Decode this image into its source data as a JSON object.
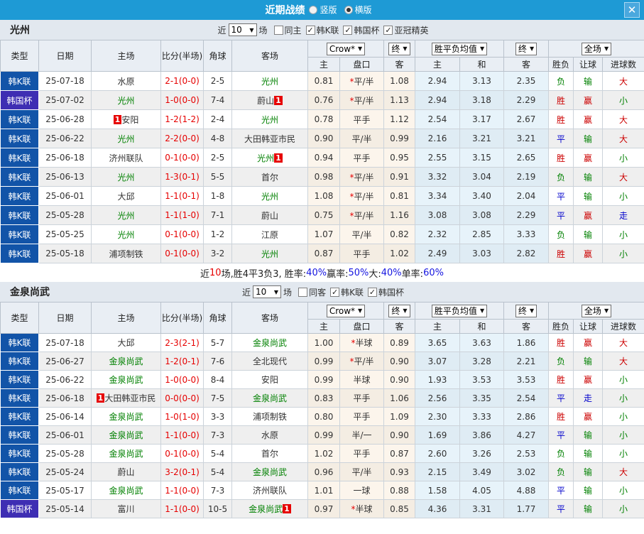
{
  "titlebar": {
    "title": "近期战绩",
    "radios": [
      {
        "label": "竖版",
        "checked": false
      },
      {
        "label": "横版",
        "checked": true
      }
    ],
    "close": "✕"
  },
  "colors": {
    "titlebar_blue": "#1e9ad5",
    "league_badge_blue": "#1254a8",
    "cup_badge_purple": "#3e2eb3",
    "focus_team_green": "#008000",
    "score_red": "#e60000",
    "win_red": "#cc0000",
    "draw_blue": "#0000cc",
    "lose_green": "#008000",
    "odds_col_cream": "#fcf5ec",
    "avg_col_blue": "#e7f3fa"
  },
  "sections": [
    {
      "team": "光州",
      "filter": {
        "near_label": "近",
        "count": "10",
        "matches_label": "场",
        "checkboxes": [
          {
            "label": "同主",
            "checked": false
          },
          {
            "label": "韩K联",
            "checked": true
          },
          {
            "label": "韩国杯",
            "checked": true
          },
          {
            "label": "亚冠精英",
            "checked": true
          }
        ]
      },
      "header": {
        "cols": [
          "类型",
          "日期",
          "主场",
          "比分(半场)",
          "角球",
          "客场"
        ],
        "book_select": "Crow*",
        "final_select1": "终",
        "avg_select": "胜平负均值",
        "final_select2": "终",
        "scope_select": "全场",
        "sub_cols": [
          "主",
          "盘口",
          "客",
          "主",
          "和",
          "客",
          "胜负",
          "让球",
          "进球数"
        ]
      },
      "rows": [
        {
          "league": "韩K联",
          "date": "25-07-18",
          "home": {
            "name": "水原"
          },
          "score": "2-1(0-0)",
          "corner": "2-5",
          "away": {
            "name": "光州",
            "focus": true
          },
          "crow": [
            "0.81",
            "*平/半",
            "1.08"
          ],
          "avg": [
            "2.94",
            "3.13",
            "2.35"
          ],
          "res": [
            "负",
            "输",
            "大"
          ]
        },
        {
          "league": "韩国杯",
          "date": "25-07-02",
          "home": {
            "name": "光州",
            "focus": true
          },
          "score": "1-0(0-0)",
          "corner": "7-4",
          "away": {
            "name": "蔚山",
            "badge_post": "1"
          },
          "crow": [
            "0.76",
            "*平/半",
            "1.13"
          ],
          "avg": [
            "2.94",
            "3.18",
            "2.29"
          ],
          "res": [
            "胜",
            "赢",
            "小"
          ]
        },
        {
          "league": "韩K联",
          "date": "25-06-28",
          "home": {
            "name": "安阳",
            "badge_pre": "1"
          },
          "score": "1-2(1-2)",
          "corner": "2-4",
          "away": {
            "name": "光州",
            "focus": true
          },
          "crow": [
            "0.78",
            "平手",
            "1.12"
          ],
          "avg": [
            "2.54",
            "3.17",
            "2.67"
          ],
          "res": [
            "胜",
            "赢",
            "大"
          ]
        },
        {
          "league": "韩K联",
          "date": "25-06-22",
          "home": {
            "name": "光州",
            "focus": true
          },
          "score": "2-2(0-0)",
          "corner": "4-8",
          "away": {
            "name": "大田韩亚市民"
          },
          "crow": [
            "0.90",
            "平/半",
            "0.99"
          ],
          "avg": [
            "2.16",
            "3.21",
            "3.21"
          ],
          "res": [
            "平",
            "输",
            "大"
          ]
        },
        {
          "league": "韩K联",
          "date": "25-06-18",
          "home": {
            "name": "济州联队"
          },
          "score": "0-1(0-0)",
          "corner": "2-5",
          "away": {
            "name": "光州",
            "focus": true,
            "badge_post": "1"
          },
          "crow": [
            "0.94",
            "平手",
            "0.95"
          ],
          "avg": [
            "2.55",
            "3.15",
            "2.65"
          ],
          "res": [
            "胜",
            "赢",
            "小"
          ]
        },
        {
          "league": "韩K联",
          "date": "25-06-13",
          "home": {
            "name": "光州",
            "focus": true
          },
          "score": "1-3(0-1)",
          "corner": "5-5",
          "away": {
            "name": "首尔"
          },
          "crow": [
            "0.98",
            "*平/半",
            "0.91"
          ],
          "avg": [
            "3.32",
            "3.04",
            "2.19"
          ],
          "res": [
            "负",
            "输",
            "大"
          ]
        },
        {
          "league": "韩K联",
          "date": "25-06-01",
          "home": {
            "name": "大邱"
          },
          "score": "1-1(0-1)",
          "corner": "1-8",
          "away": {
            "name": "光州",
            "focus": true
          },
          "crow": [
            "1.08",
            "*平/半",
            "0.81"
          ],
          "avg": [
            "3.34",
            "3.40",
            "2.04"
          ],
          "res": [
            "平",
            "输",
            "小"
          ]
        },
        {
          "league": "韩K联",
          "date": "25-05-28",
          "home": {
            "name": "光州",
            "focus": true
          },
          "score": "1-1(1-0)",
          "corner": "7-1",
          "away": {
            "name": "蔚山"
          },
          "crow": [
            "0.75",
            "*平/半",
            "1.16"
          ],
          "avg": [
            "3.08",
            "3.08",
            "2.29"
          ],
          "res": [
            "平",
            "赢",
            "走"
          ]
        },
        {
          "league": "韩K联",
          "date": "25-05-25",
          "home": {
            "name": "光州",
            "focus": true
          },
          "score": "0-1(0-0)",
          "corner": "1-2",
          "away": {
            "name": "江原"
          },
          "crow": [
            "1.07",
            "平/半",
            "0.82"
          ],
          "avg": [
            "2.32",
            "2.85",
            "3.33"
          ],
          "res": [
            "负",
            "输",
            "小"
          ]
        },
        {
          "league": "韩K联",
          "date": "25-05-18",
          "home": {
            "name": "浦项制铁"
          },
          "score": "0-1(0-0)",
          "corner": "3-2",
          "away": {
            "name": "光州",
            "focus": true
          },
          "crow": [
            "0.87",
            "平手",
            "1.02"
          ],
          "avg": [
            "2.49",
            "3.03",
            "2.82"
          ],
          "res": [
            "胜",
            "赢",
            "小"
          ]
        }
      ],
      "summary": {
        "parts": [
          {
            "text": "近",
            "color": "black"
          },
          {
            "text": "10",
            "color": "red"
          },
          {
            "text": "场,胜4平3负3, 胜率:",
            "color": "black"
          },
          {
            "text": "40%",
            "color": "blue"
          },
          {
            "text": " 赢率:",
            "color": "black"
          },
          {
            "text": "50%",
            "color": "blue"
          },
          {
            "text": " 大:",
            "color": "black"
          },
          {
            "text": "40%",
            "color": "blue"
          },
          {
            "text": " 单率:",
            "color": "black"
          },
          {
            "text": "60%",
            "color": "blue"
          }
        ]
      }
    },
    {
      "team": "金泉尚武",
      "filter": {
        "near_label": "近",
        "count": "10",
        "matches_label": "场",
        "checkboxes": [
          {
            "label": "同客",
            "checked": false
          },
          {
            "label": "韩K联",
            "checked": true
          },
          {
            "label": "韩国杯",
            "checked": true
          }
        ]
      },
      "header": {
        "cols": [
          "类型",
          "日期",
          "主场",
          "比分(半场)",
          "角球",
          "客场"
        ],
        "book_select": "Crow*",
        "final_select1": "终",
        "avg_select": "胜平负均值",
        "final_select2": "终",
        "scope_select": "全场",
        "sub_cols": [
          "主",
          "盘口",
          "客",
          "主",
          "和",
          "客",
          "胜负",
          "让球",
          "进球数"
        ]
      },
      "rows": [
        {
          "league": "韩K联",
          "date": "25-07-18",
          "home": {
            "name": "大邱"
          },
          "score": "2-3(2-1)",
          "corner": "5-7",
          "away": {
            "name": "金泉尚武",
            "focus": true
          },
          "crow": [
            "1.00",
            "*半球",
            "0.89"
          ],
          "avg": [
            "3.65",
            "3.63",
            "1.86"
          ],
          "res": [
            "胜",
            "赢",
            "大"
          ]
        },
        {
          "league": "韩K联",
          "date": "25-06-27",
          "home": {
            "name": "金泉尚武",
            "focus": true
          },
          "score": "1-2(0-1)",
          "corner": "7-6",
          "away": {
            "name": "全北现代"
          },
          "crow": [
            "0.99",
            "*平/半",
            "0.90"
          ],
          "avg": [
            "3.07",
            "3.28",
            "2.21"
          ],
          "res": [
            "负",
            "输",
            "大"
          ]
        },
        {
          "league": "韩K联",
          "date": "25-06-22",
          "home": {
            "name": "金泉尚武",
            "focus": true
          },
          "score": "1-0(0-0)",
          "corner": "8-4",
          "away": {
            "name": "安阳"
          },
          "crow": [
            "0.99",
            "半球",
            "0.90"
          ],
          "avg": [
            "1.93",
            "3.53",
            "3.53"
          ],
          "res": [
            "胜",
            "赢",
            "小"
          ]
        },
        {
          "league": "韩K联",
          "date": "25-06-18",
          "home": {
            "name": "大田韩亚市民",
            "badge_pre": "1"
          },
          "score": "0-0(0-0)",
          "corner": "7-5",
          "away": {
            "name": "金泉尚武",
            "focus": true
          },
          "crow": [
            "0.83",
            "平手",
            "1.06"
          ],
          "avg": [
            "2.56",
            "3.35",
            "2.54"
          ],
          "res": [
            "平",
            "走",
            "小"
          ]
        },
        {
          "league": "韩K联",
          "date": "25-06-14",
          "home": {
            "name": "金泉尚武",
            "focus": true
          },
          "score": "1-0(1-0)",
          "corner": "3-3",
          "away": {
            "name": "浦项制铁"
          },
          "crow": [
            "0.80",
            "平手",
            "1.09"
          ],
          "avg": [
            "2.30",
            "3.33",
            "2.86"
          ],
          "res": [
            "胜",
            "赢",
            "小"
          ]
        },
        {
          "league": "韩K联",
          "date": "25-06-01",
          "home": {
            "name": "金泉尚武",
            "focus": true
          },
          "score": "1-1(0-0)",
          "corner": "7-3",
          "away": {
            "name": "水原"
          },
          "crow": [
            "0.99",
            "半/一",
            "0.90"
          ],
          "avg": [
            "1.69",
            "3.86",
            "4.27"
          ],
          "res": [
            "平",
            "输",
            "小"
          ]
        },
        {
          "league": "韩K联",
          "date": "25-05-28",
          "home": {
            "name": "金泉尚武",
            "focus": true
          },
          "score": "0-1(0-0)",
          "corner": "5-4",
          "away": {
            "name": "首尔"
          },
          "crow": [
            "1.02",
            "平手",
            "0.87"
          ],
          "avg": [
            "2.60",
            "3.26",
            "2.53"
          ],
          "res": [
            "负",
            "输",
            "小"
          ]
        },
        {
          "league": "韩K联",
          "date": "25-05-24",
          "home": {
            "name": "蔚山"
          },
          "score": "3-2(0-1)",
          "corner": "5-4",
          "away": {
            "name": "金泉尚武",
            "focus": true
          },
          "crow": [
            "0.96",
            "平/半",
            "0.93"
          ],
          "avg": [
            "2.15",
            "3.49",
            "3.02"
          ],
          "res": [
            "负",
            "输",
            "大"
          ]
        },
        {
          "league": "韩K联",
          "date": "25-05-17",
          "home": {
            "name": "金泉尚武",
            "focus": true
          },
          "score": "1-1(0-0)",
          "corner": "7-3",
          "away": {
            "name": "济州联队"
          },
          "crow": [
            "1.01",
            "一球",
            "0.88"
          ],
          "avg": [
            "1.58",
            "4.05",
            "4.88"
          ],
          "res": [
            "平",
            "输",
            "小"
          ]
        },
        {
          "league": "韩国杯",
          "date": "25-05-14",
          "home": {
            "name": "富川"
          },
          "score": "1-1(0-0)",
          "corner": "10-5",
          "away": {
            "name": "金泉尚武",
            "focus": true,
            "badge_post": "1"
          },
          "crow": [
            "0.97",
            "*半球",
            "0.85"
          ],
          "avg": [
            "4.36",
            "3.31",
            "1.77"
          ],
          "res": [
            "平",
            "输",
            "小"
          ]
        }
      ]
    }
  ]
}
